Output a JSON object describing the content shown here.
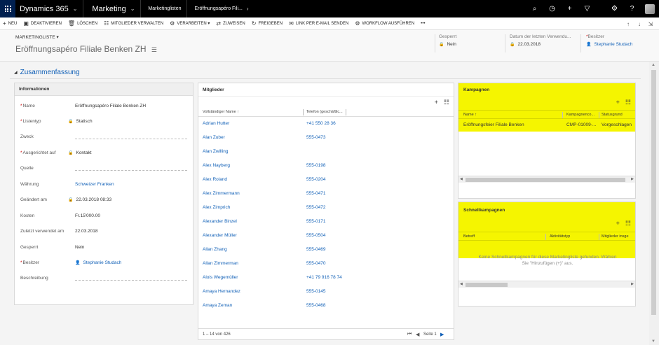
{
  "topbar": {
    "brand": "Dynamics 365",
    "area": "Marketing",
    "breadcrumb_1": "Marketinglisten",
    "breadcrumb_2": "Eröffnungsapéro Fili...",
    "icons": [
      "search-icon",
      "history-icon",
      "plus-icon",
      "filter-icon",
      "gear-icon",
      "help-icon"
    ]
  },
  "commands": [
    {
      "icon": "+",
      "label": "NEU"
    },
    {
      "icon": "▣",
      "label": "DEAKTIVIEREN"
    },
    {
      "icon": "🗑",
      "label": "LÖSCHEN"
    },
    {
      "icon": "☷",
      "label": "MITGLIEDER VERWALTEN"
    },
    {
      "icon": "⚙",
      "label": "VERARBEITEN ▾"
    },
    {
      "icon": "⇄",
      "label": "ZUWEISEN"
    },
    {
      "icon": "↻",
      "label": "FREIGEBEN"
    },
    {
      "icon": "✉",
      "label": "LINK PER E-MAIL SENDEN"
    },
    {
      "icon": "⚙",
      "label": "WORKFLOW AUSFÜHREN"
    },
    {
      "icon": "",
      "label": "•••"
    }
  ],
  "header": {
    "entity_label": "MARKETINGLISTE ▾",
    "title": "Eröffnungsapéro Filiale Benken ZH",
    "locked_label": "Gesperrt",
    "locked_value": "Nein",
    "last_used_label": "Datum der letzten Verwendu...",
    "last_used_value": "22.03.2018",
    "owner_label": "Besitzer",
    "owner_value": "Stephanie Studach"
  },
  "section": {
    "title": "Zusammenfassung"
  },
  "info": {
    "title": "Informationen",
    "fields": [
      {
        "label": "Name",
        "value": "Eröffnungsapéro Filiale Benken ZH",
        "required": true
      },
      {
        "label": "Listentyp",
        "value": "Statisch",
        "required": true,
        "locked": true
      },
      {
        "label": "Zweck",
        "value": ""
      },
      {
        "label": "Ausgerichtet auf",
        "value": "Kontakt",
        "required": true,
        "locked": true
      },
      {
        "label": "Quelle",
        "value": ""
      },
      {
        "label": "Währung",
        "value": "Schweizer Franken",
        "link": true
      },
      {
        "label": "Geändert am",
        "value": "22.03.2018   08:33",
        "locked": true
      },
      {
        "label": "Kosten",
        "value": "Fr.15'000.00"
      },
      {
        "label": "Zuletzt verwendet am",
        "value": "22.03.2018"
      },
      {
        "label": "Gesperrt",
        "value": "Nein"
      },
      {
        "label": "Besitzer",
        "value": "Stephanie Studach",
        "required": true,
        "link": true,
        "person": true
      },
      {
        "label": "Beschreibung",
        "value": ""
      }
    ]
  },
  "members": {
    "title": "Mitglieder",
    "col_name": "Vollständiger Name ↑",
    "col_phone": "Telefon (geschäftlic...",
    "rows": [
      {
        "name": "Adrian Hutter",
        "phone": "+41 550 28 36"
      },
      {
        "name": "Alan Zuber",
        "phone": "555-0473"
      },
      {
        "name": "Alan Zwilling",
        "phone": ""
      },
      {
        "name": "Alex Nayberg",
        "phone": "555-0198"
      },
      {
        "name": "Alex Roland",
        "phone": "555-0204"
      },
      {
        "name": "Alex Zimmermann",
        "phone": "555-0471"
      },
      {
        "name": "Alex Zimprich",
        "phone": "555-0472"
      },
      {
        "name": "Alexander Binzel",
        "phone": "555-0171"
      },
      {
        "name": "Alexander Müller",
        "phone": "555-0504"
      },
      {
        "name": "Allan Zhang",
        "phone": "555-0469"
      },
      {
        "name": "Allan Zimmerman",
        "phone": "555-0470"
      },
      {
        "name": "Alois Wegemüller",
        "phone": "+41 79 916 78 74"
      },
      {
        "name": "Amaya Hernandez",
        "phone": "555-0145"
      },
      {
        "name": "Amaya Zeman",
        "phone": "555-0468"
      }
    ],
    "footer_range": "1 – 14  von 426",
    "footer_page": "Seite 1"
  },
  "campaigns": {
    "title": "Kampagnen",
    "col_name": "Name ↑",
    "col_code": "Kampagnenco...",
    "col_reason": "Statusgrund",
    "row_name": "Eröffnungsfeier Filiale Benken",
    "row_code": "CMP-01009-...",
    "row_reason": "Vorgeschlagen"
  },
  "quick": {
    "title": "Schnellkampagnen",
    "col_subject": "Betreff",
    "col_type": "Aktivitätstyp",
    "col_members": "Mitglieder insge",
    "empty_line1": "Keine Schnellkampagnen für diese Marketingliste gefunden. Wählen",
    "empty_line2": "Sie \"Hinzufügen (+)\" aus."
  },
  "colors": {
    "highlight": "#f5f500",
    "link": "#1160b7",
    "topbar": "#000000"
  }
}
